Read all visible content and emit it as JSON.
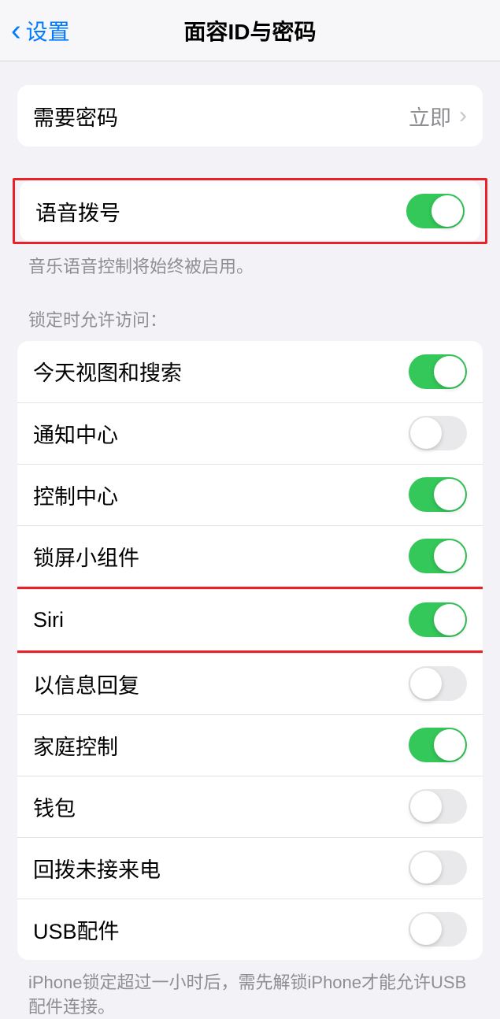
{
  "nav": {
    "back_label": "设置",
    "title": "面容ID与密码"
  },
  "require_passcode": {
    "label": "需要密码",
    "value": "立即"
  },
  "voice_dial": {
    "label": "语音拨号",
    "on": true,
    "footer": "音乐语音控制将始终被启用。"
  },
  "lock_access": {
    "header": "锁定时允许访问：",
    "items": [
      {
        "label": "今天视图和搜索",
        "on": true
      },
      {
        "label": "通知中心",
        "on": false
      },
      {
        "label": "控制中心",
        "on": true
      },
      {
        "label": "锁屏小组件",
        "on": true
      },
      {
        "label": "Siri",
        "on": true
      },
      {
        "label": "以信息回复",
        "on": false
      },
      {
        "label": "家庭控制",
        "on": true
      },
      {
        "label": "钱包",
        "on": false
      },
      {
        "label": "回拨未接来电",
        "on": false
      },
      {
        "label": "USB配件",
        "on": false
      }
    ],
    "footer": "iPhone锁定超过一小时后，需先解锁iPhone才能允许USB配件连接。"
  }
}
